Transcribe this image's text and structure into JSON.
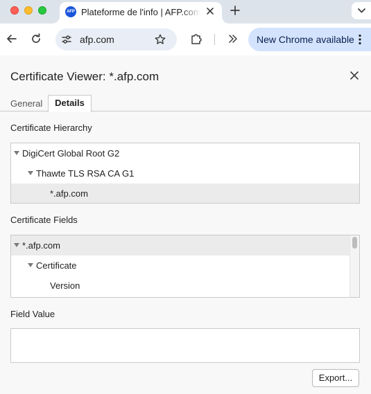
{
  "browser": {
    "tab": {
      "favicon_text": "AFP",
      "title": "Plateforme de l'info | AFP.com"
    },
    "omnibox": {
      "url": "afp.com"
    },
    "update_chip": {
      "label": "New Chrome available"
    },
    "icons": {
      "close_window": "red-traffic-light",
      "minimize_window": "yellow-traffic-light",
      "maximize_window": "green-traffic-light",
      "tab_close": "close-icon",
      "new_tab": "plus-icon",
      "tab_search": "chevron-down-icon",
      "back": "arrow-left-icon",
      "reload": "reload-icon",
      "site_info": "tune-icon",
      "bookmark": "star-icon",
      "extensions": "puzzle-icon",
      "overflow": "double-chevron-right-icon",
      "update_menu": "kebab-icon"
    }
  },
  "certificate_viewer": {
    "title": "Certificate Viewer: *.afp.com",
    "tabs": [
      {
        "label": "General",
        "active": false
      },
      {
        "label": "Details",
        "active": true
      }
    ],
    "hierarchy": {
      "label": "Certificate Hierarchy",
      "items": [
        {
          "label": "DigiCert Global Root G2",
          "expanded": true,
          "selected": false
        },
        {
          "label": "Thawte TLS RSA CA G1",
          "expanded": true,
          "selected": false
        },
        {
          "label": "*.afp.com",
          "expanded": false,
          "selected": true
        }
      ]
    },
    "fields": {
      "label": "Certificate Fields",
      "items": [
        {
          "label": "*.afp.com",
          "expanded": true,
          "selected": true
        },
        {
          "label": "Certificate",
          "expanded": true,
          "selected": false
        },
        {
          "label": "Version",
          "expanded": false,
          "selected": false
        }
      ]
    },
    "field_value": {
      "label": "Field Value",
      "value": ""
    },
    "export_button": "Export..."
  },
  "colors": {
    "tabstrip_bg": "#dde3ea",
    "omnibox_bg": "#e9eef6",
    "update_chip_bg": "#d3e3fd",
    "favicon_bg": "#1a56db",
    "dialog_bg": "#f8f8f8",
    "selected_row_bg": "#ebebeb"
  }
}
